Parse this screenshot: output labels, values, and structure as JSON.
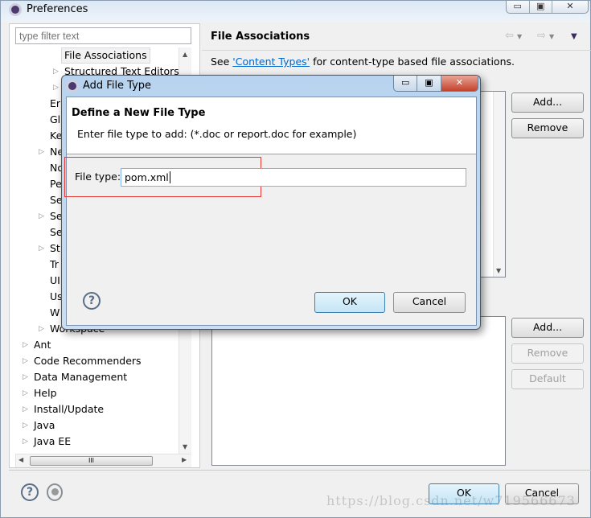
{
  "window": {
    "title": "Preferences",
    "controls": [
      "▭",
      "▣",
      "✕"
    ]
  },
  "filter": {
    "placeholder": "type filter text"
  },
  "tree": {
    "items": [
      {
        "label": "File Associations",
        "level": 2,
        "selected": true,
        "arrow": false
      },
      {
        "label": "Structured Text Editors",
        "level": 2,
        "arrow": true
      },
      {
        "label": "",
        "level": 2,
        "arrow": true
      },
      {
        "label": "Er",
        "level": 1,
        "arrow": false
      },
      {
        "label": "Gl",
        "level": 1,
        "arrow": false
      },
      {
        "label": "Ke",
        "level": 1,
        "arrow": false
      },
      {
        "label": "Ne",
        "level": 1,
        "arrow": true
      },
      {
        "label": "No",
        "level": 1,
        "arrow": false
      },
      {
        "label": "Pe",
        "level": 1,
        "arrow": false
      },
      {
        "label": "Se",
        "level": 1,
        "arrow": false
      },
      {
        "label": "Se",
        "level": 1,
        "arrow": true
      },
      {
        "label": "Se",
        "level": 1,
        "arrow": false
      },
      {
        "label": "St",
        "level": 1,
        "arrow": true
      },
      {
        "label": "Tr",
        "level": 1,
        "arrow": false
      },
      {
        "label": "UI",
        "level": 1,
        "arrow": false
      },
      {
        "label": "Us",
        "level": 1,
        "arrow": false
      },
      {
        "label": "W",
        "level": 1,
        "arrow": false
      },
      {
        "label": "Workspace",
        "level": 1,
        "arrow": true
      },
      {
        "label": "Ant",
        "level": 0,
        "arrow": true
      },
      {
        "label": "Code Recommenders",
        "level": 0,
        "arrow": true
      },
      {
        "label": "Data Management",
        "level": 0,
        "arrow": true
      },
      {
        "label": "Help",
        "level": 0,
        "arrow": true
      },
      {
        "label": "Install/Update",
        "level": 0,
        "arrow": true
      },
      {
        "label": "Java",
        "level": 0,
        "arrow": true
      },
      {
        "label": "Java EE",
        "level": 0,
        "arrow": true
      }
    ]
  },
  "page": {
    "title": "File Associations",
    "see": "See ",
    "link": "'Content Types'",
    "see_rest": " for content-type based file associations."
  },
  "file_types": {
    "add": "Add...",
    "remove": "Remove"
  },
  "editors": {
    "add": "Add...",
    "remove": "Remove",
    "default": "Default"
  },
  "footer": {
    "ok": "OK",
    "cancel": "Cancel"
  },
  "dialog": {
    "title": "Add File Type",
    "heading": "Define a New File Type",
    "message": "Enter file type to add: (*.doc or report.doc for example)",
    "field_label": "File type:",
    "field_value": "pom.xml",
    "ok": "OK",
    "cancel": "Cancel",
    "controls": [
      "▭",
      "▣",
      "✕"
    ]
  },
  "watermark": "https://blog.csdn.net/w719566673",
  "colors": {
    "link": "#0066cc",
    "highlight_box": "#e53935",
    "default_button": "#3c7fb1"
  }
}
